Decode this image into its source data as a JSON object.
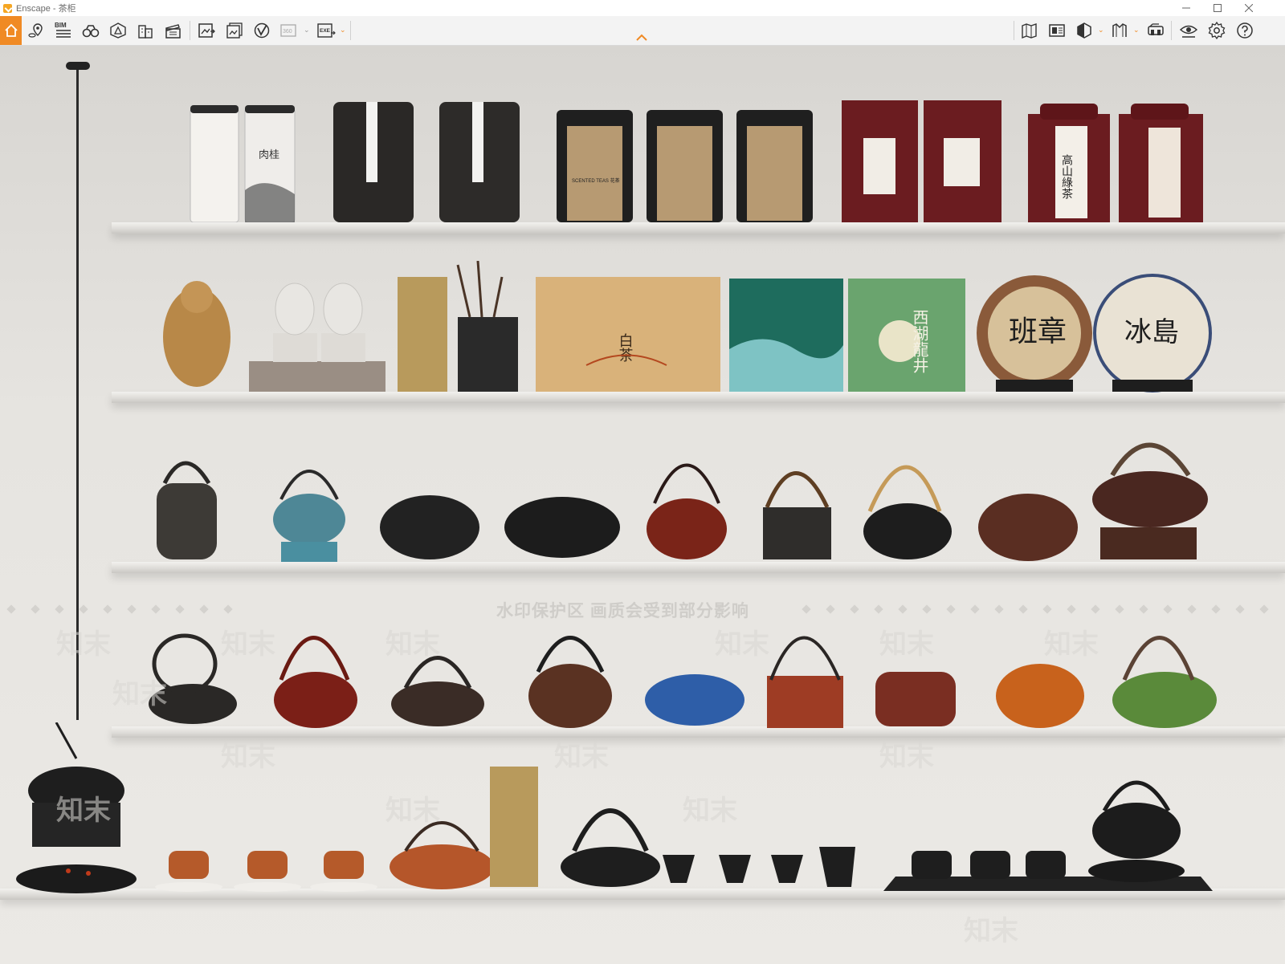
{
  "window": {
    "title": "Enscape - 茶柜",
    "controls": [
      "minimize-icon",
      "maximize-icon",
      "close-icon"
    ]
  },
  "toolbar": {
    "left_icons": [
      "home-icon",
      "location-pin-icon",
      "bim-icon",
      "binoculars-icon",
      "section-icon",
      "buildings-icon",
      "clapperboard-icon",
      "export-image-icon",
      "batch-render-icon",
      "web-standalone-icon",
      "panorama-360-icon",
      "exe-export-icon"
    ],
    "bim_label": "BIM",
    "pano_label": "360",
    "exe_label": "EXE",
    "right_icons": [
      "map-icon",
      "material-editor-icon",
      "section-cube-icon",
      "asset-library-icon",
      "vr-headset-icon",
      "visual-settings-icon",
      "settings-gear-icon",
      "help-icon"
    ],
    "collapse_icon": "chevron-up-icon",
    "accent_color": "#f08a24"
  },
  "viewport": {
    "watermark_label": "水印保护区  画质会受到部分影响",
    "watermark_tiles": [
      "知末",
      "知末",
      "知末",
      "知末",
      "知末",
      "知末",
      "知末",
      "知末",
      "知末",
      "知末",
      "知末",
      "知末",
      "知末",
      "知末"
    ],
    "row1_labels": [
      "肉桂",
      "SCENTED TEAS 花茶",
      "高山綠茶"
    ],
    "row2_labels": [
      "白茶",
      "西湖龍井",
      "班章",
      "冰島"
    ]
  }
}
